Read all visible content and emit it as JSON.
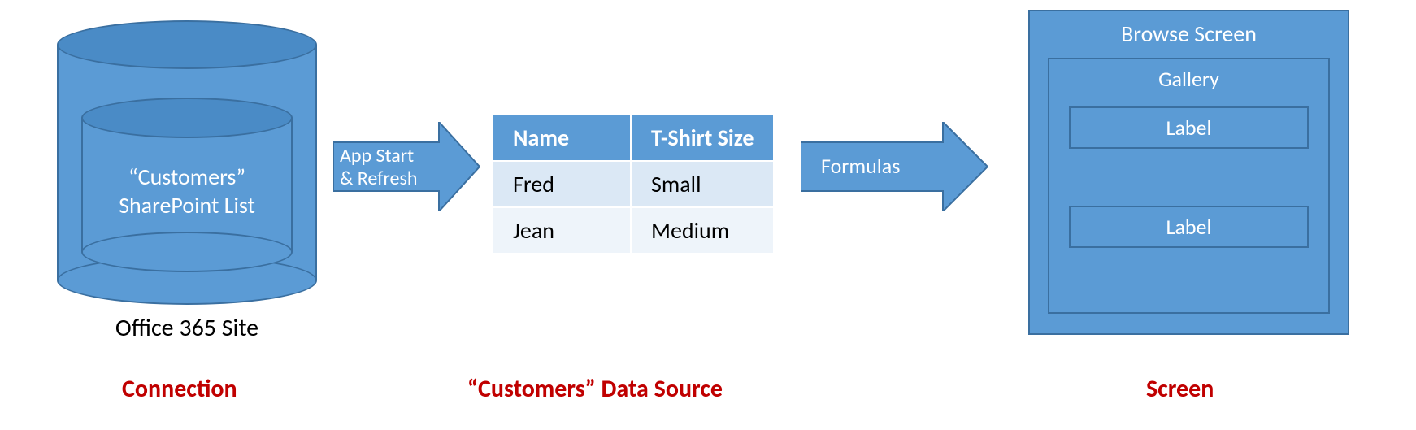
{
  "connection": {
    "inner_label_line1": "“Customers”",
    "inner_label_line2": "SharePoint List",
    "site_caption": "Office 365 Site",
    "section_caption": "Connection"
  },
  "arrow1": {
    "label_line1": "App Start",
    "label_line2": "& Refresh"
  },
  "datasource": {
    "section_caption": "“Customers” Data Source",
    "table": {
      "header_name": "Name",
      "header_size": "T-Shirt Size",
      "rows": [
        {
          "name": "Fred",
          "size": "Small"
        },
        {
          "name": "Jean",
          "size": "Medium"
        }
      ]
    }
  },
  "arrow2": {
    "label": "Formulas"
  },
  "screen": {
    "title": "Browse Screen",
    "gallery_title": "Gallery",
    "label1": "Label",
    "label2": "Label",
    "section_caption": "Screen"
  },
  "chart_data": {
    "type": "table",
    "title": "\"Customers\" Data Source",
    "columns": [
      "Name",
      "T-Shirt Size"
    ],
    "rows": [
      [
        "Fred",
        "Small"
      ],
      [
        "Jean",
        "Medium"
      ]
    ]
  }
}
